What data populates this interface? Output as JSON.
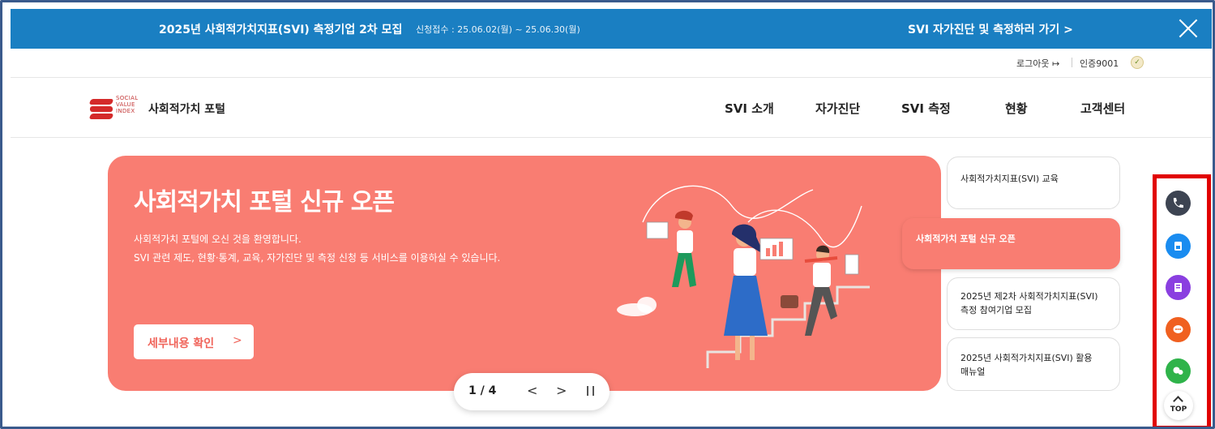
{
  "banner": {
    "title": "2025년 사회적가치지표(SVI) 측정기업 2차 모집",
    "period": "신청접수 : 25.06.02(월) ~ 25.06.30(월)",
    "link": "SVI 자가진단 및 측정하러 가기 >"
  },
  "util": {
    "logout": "로그아웃",
    "auth": "인증9001"
  },
  "logo": {
    "lines": [
      "SOCIAL",
      "VALUE",
      "INDEX"
    ]
  },
  "header": {
    "site_name": "사회적가치 포털",
    "nav": [
      "SVI 소개",
      "자가진단",
      "SVI 측정",
      "현황",
      "고객센터"
    ]
  },
  "hero": {
    "title": "사회적가치 포털 신규 오픈",
    "desc1": "사회적가치 포털에 오신 것을 환영합니다.",
    "desc2": "SVI 관련 제도, 현황·통계, 교육, 자가진단 및 측정 신청 등 서비스를 이용하실 수 있습니다.",
    "button": "세부내용 확인",
    "button_chevron": ">"
  },
  "pager": {
    "current": "1 / 4",
    "prev": "<",
    "next": ">"
  },
  "tabs": [
    {
      "label": "사회적가치지표(SVI) 교육"
    },
    {
      "label": "사회적가치 포털 신규 오픈"
    },
    {
      "label": "2025년 제2차 사회적가치지표(SVI) 측정 참여기업 모집"
    },
    {
      "label": "2025년 사회적가치지표(SVI) 활용 매뉴얼"
    }
  ],
  "quick_menu": {
    "items": [
      {
        "icon": "phone-icon",
        "color": "#3d4452"
      },
      {
        "icon": "document-icon",
        "color": "#1a8cf0"
      },
      {
        "icon": "book-icon",
        "color": "#8a3fe0"
      },
      {
        "icon": "chat-icon",
        "color": "#f06020"
      },
      {
        "icon": "talk-icon",
        "color": "#2fb34a"
      }
    ],
    "top_label": "TOP"
  },
  "colors": {
    "banner": "#1a7fc2",
    "hero": "#f97d72",
    "highlight": "#e10000"
  }
}
